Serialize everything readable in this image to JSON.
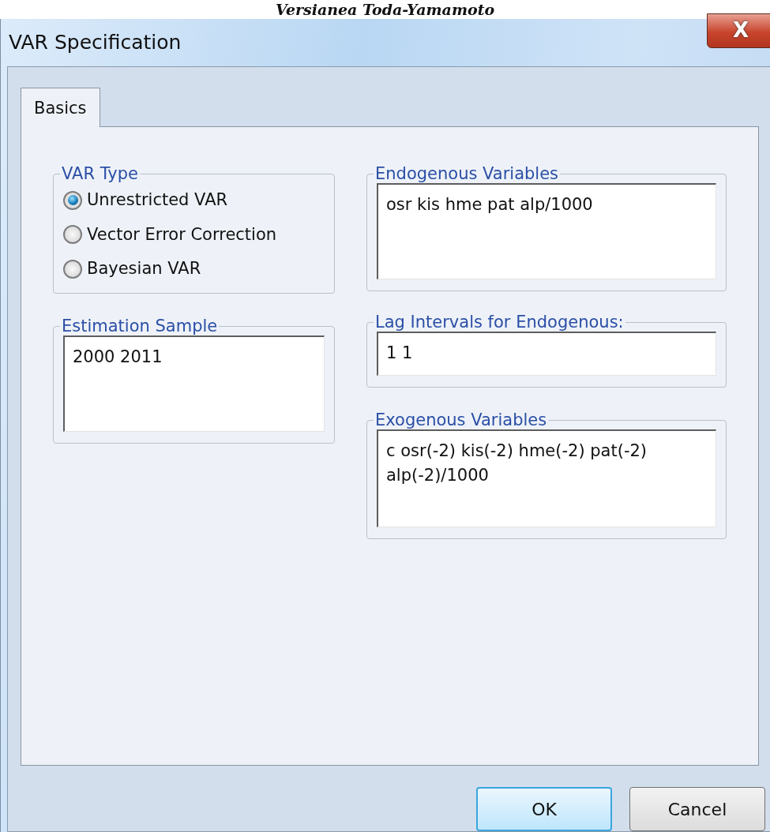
{
  "caption": "Versianea Toda-Yamamoto",
  "window": {
    "title": "VAR Specification",
    "close": "X"
  },
  "tabs": [
    {
      "label": "Basics",
      "selected": true
    }
  ],
  "var_type": {
    "legend": "VAR Type",
    "options": [
      {
        "label": "Unrestricted VAR",
        "selected": true
      },
      {
        "label": "Vector Error Correction",
        "selected": false
      },
      {
        "label": "Bayesian VAR",
        "selected": false
      }
    ]
  },
  "estimation_sample": {
    "legend": "Estimation Sample",
    "value": "2000 2011"
  },
  "endogenous_variables": {
    "legend": "Endogenous Variables",
    "value": "osr kis hme pat alp/1000"
  },
  "lag_intervals": {
    "legend": "Lag Intervals for Endogenous:",
    "value": "1 1"
  },
  "exogenous_variables": {
    "legend": "Exogenous Variables",
    "value": "c osr(-2) kis(-2) hme(-2) pat(-2) alp(-2)/1000"
  },
  "buttons": [
    {
      "label": "OK",
      "kind": "default"
    },
    {
      "label": "Cancel",
      "kind": "normal"
    }
  ]
}
